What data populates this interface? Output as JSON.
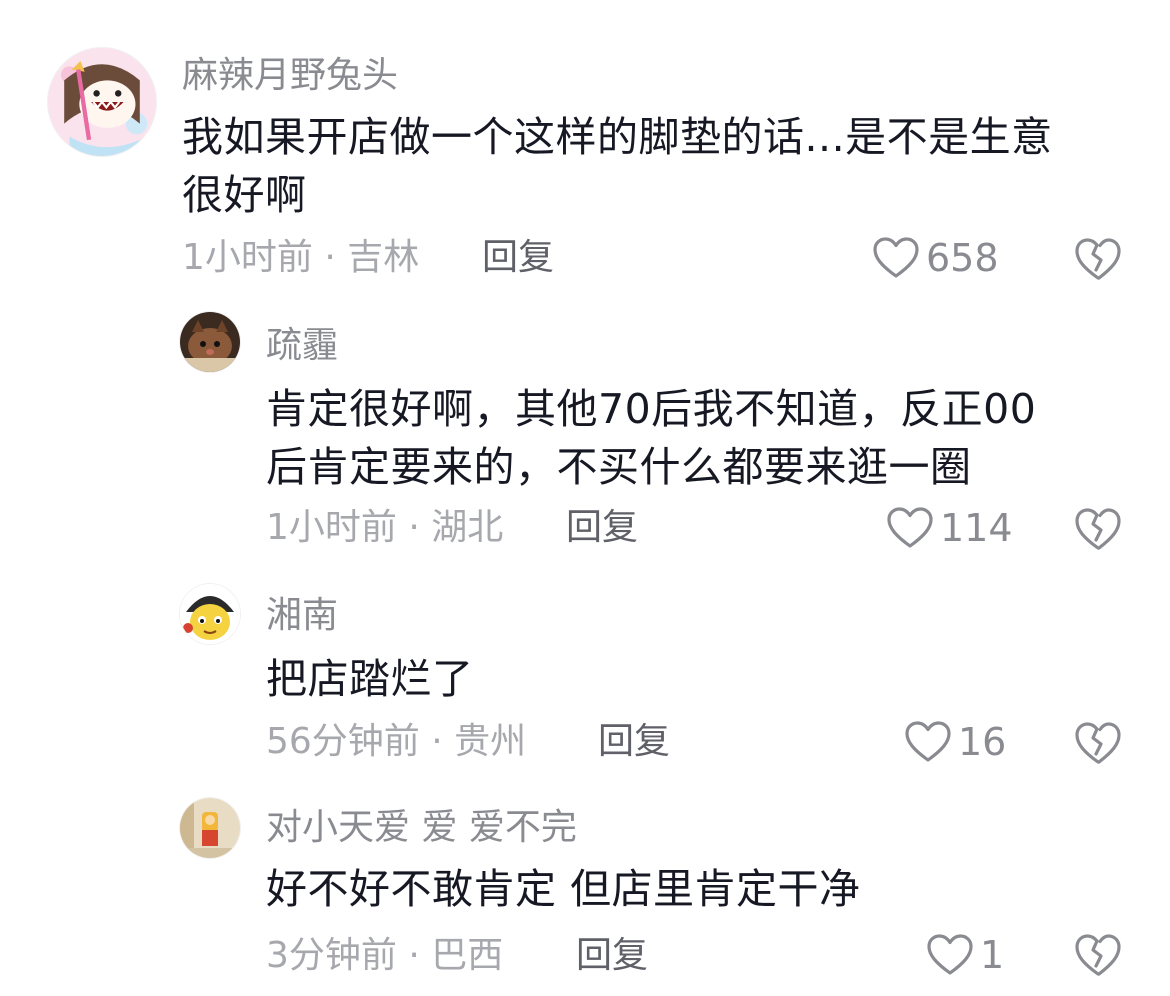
{
  "comments": [
    {
      "username": "麻辣月野兔头",
      "content_lines": [
        "我如果开店做一个这样的脚垫的话...是不是生意",
        "很好啊"
      ],
      "meta": "1小时前 · 吉林",
      "reply_label": "回复",
      "likes": "658",
      "avatar_icon": "anime-girl-avatar"
    },
    {
      "username": "疏霾",
      "content_lines": [
        "肯定很好啊，其他70后我不知道，反正00",
        "后肯定要来的，不买什么都要来逛一圈"
      ],
      "meta": "1小时前 · 湖北",
      "reply_label": "回复",
      "likes": "114",
      "avatar_icon": "cat-avatar"
    },
    {
      "username": "湘南",
      "content_lines": [
        "把店踏烂了"
      ],
      "meta": "56分钟前 · 贵州",
      "reply_label": "回复",
      "likes": "16",
      "avatar_icon": "cartoon-character-avatar"
    },
    {
      "username": "对小天爱 爱 爱不完",
      "content_lines": [
        "好不好不敢肯定 但店里肯定干净"
      ],
      "meta": "3分钟前 · 巴西",
      "reply_label": "回复",
      "likes": "1",
      "avatar_icon": "toy-figure-avatar"
    }
  ],
  "icons": {
    "like": "heart-outline-icon",
    "dislike": "broken-heart-icon"
  },
  "colors": {
    "username": "#8a8b91",
    "content": "#161823",
    "meta": "#a7a8ad",
    "reply": "#5f6068"
  }
}
